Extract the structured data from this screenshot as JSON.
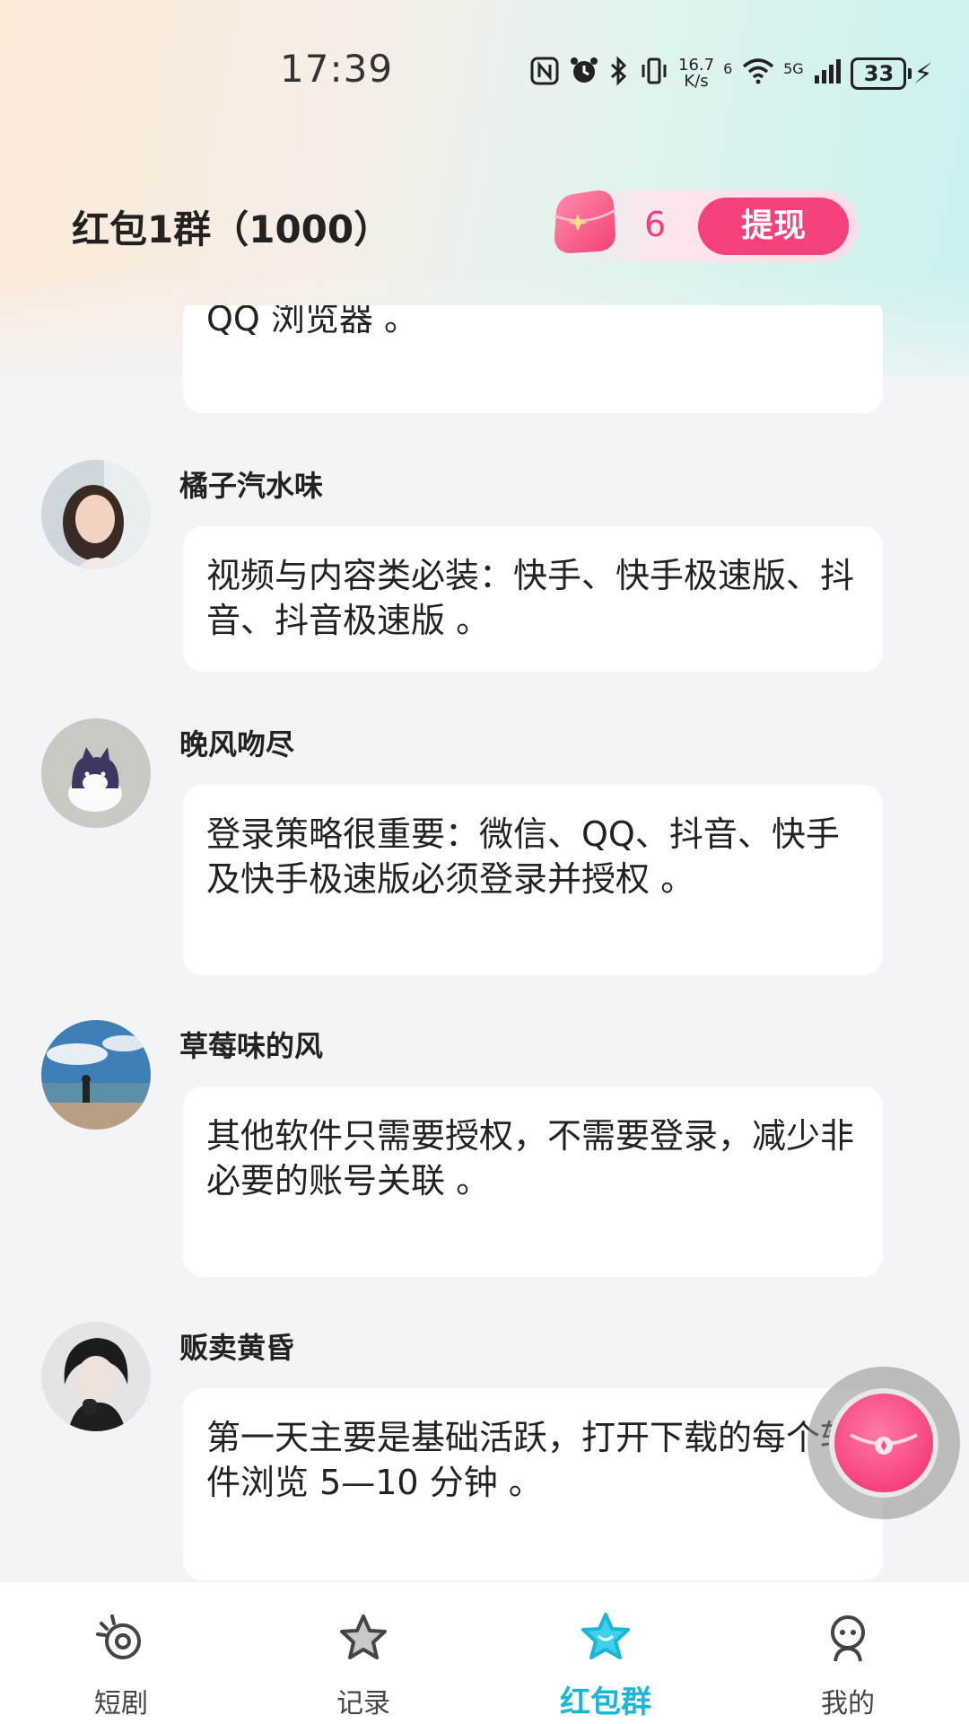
{
  "status_bar": {
    "time": "17:39",
    "speed_top": "16.7",
    "speed_unit": "K/s",
    "wifi_badge": "6",
    "net_type": "5G",
    "battery": "33"
  },
  "header": {
    "title": "红包1群（1000）",
    "coin_count": "6",
    "withdraw_label": "提现"
  },
  "messages": [
    {
      "sender": "",
      "text": "QQ 浏览器 。"
    },
    {
      "sender": "橘子汽水味",
      "text": "视频与内容类必装：快手、快手极速版、抖音、抖音极速版 。"
    },
    {
      "sender": "晚风吻尽",
      "text": "登录策略很重要：微信、QQ、抖音、快手及快手极速版必须登录并授权 。"
    },
    {
      "sender": "草莓味的风",
      "text": "其他软件只需要授权，不需要登录，减少非必要的账号关联 。"
    },
    {
      "sender": "贩卖黄昏",
      "text": "第一天主要是基础活跃，打开下载的每个软件浏览 5—10 分钟 。"
    }
  ],
  "bottom_nav": [
    {
      "label": "短剧",
      "icon": "short-drama-icon"
    },
    {
      "label": "记录",
      "icon": "star-record-icon"
    },
    {
      "label": "红包群",
      "icon": "star-active-icon",
      "active": true
    },
    {
      "label": "我的",
      "icon": "profile-icon"
    }
  ],
  "colors": {
    "accent_pink": "#f5407a",
    "active_tab": "#19b6d9"
  }
}
